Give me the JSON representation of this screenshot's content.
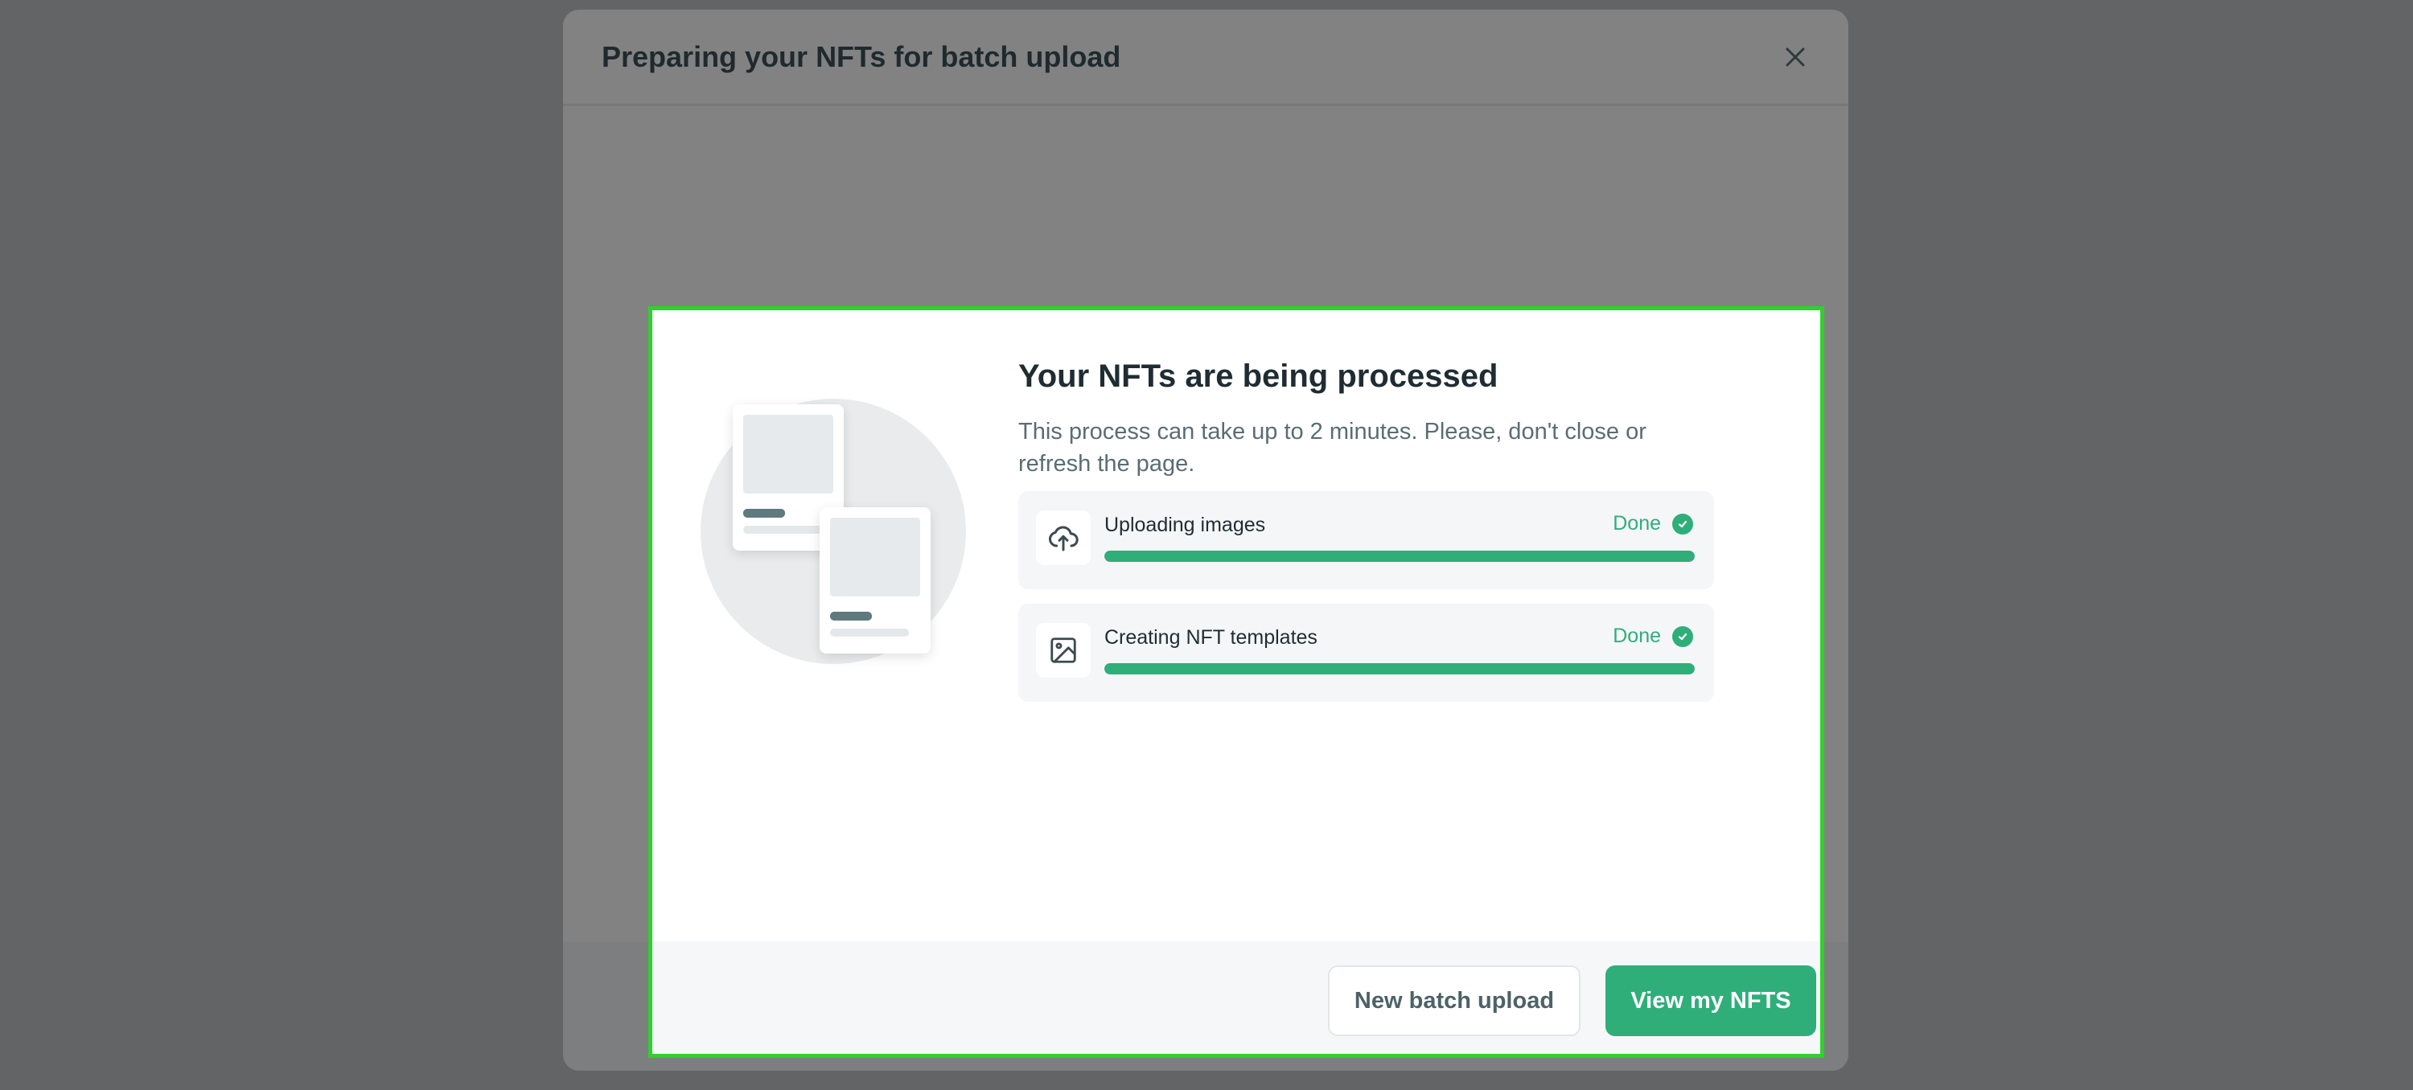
{
  "background_modal": {
    "title": "Preparing your NFTs for batch upload"
  },
  "modal": {
    "heading": "Your NFTs are being processed",
    "description": "This process can take up to 2 minutes. Please, don't close or refresh the page.",
    "steps": [
      {
        "label": "Uploading images",
        "status": "Done",
        "icon": "upload-cloud-icon",
        "progress_percent": 100
      },
      {
        "label": "Creating NFT templates",
        "status": "Done",
        "icon": "image-icon",
        "progress_percent": 100
      }
    ],
    "buttons": {
      "secondary_label": "New batch upload",
      "primary_label": "View my NFTS"
    }
  },
  "colors": {
    "accent": "#2fae7a",
    "overlay": "#636466",
    "highlight_border": "#2ed12e"
  }
}
